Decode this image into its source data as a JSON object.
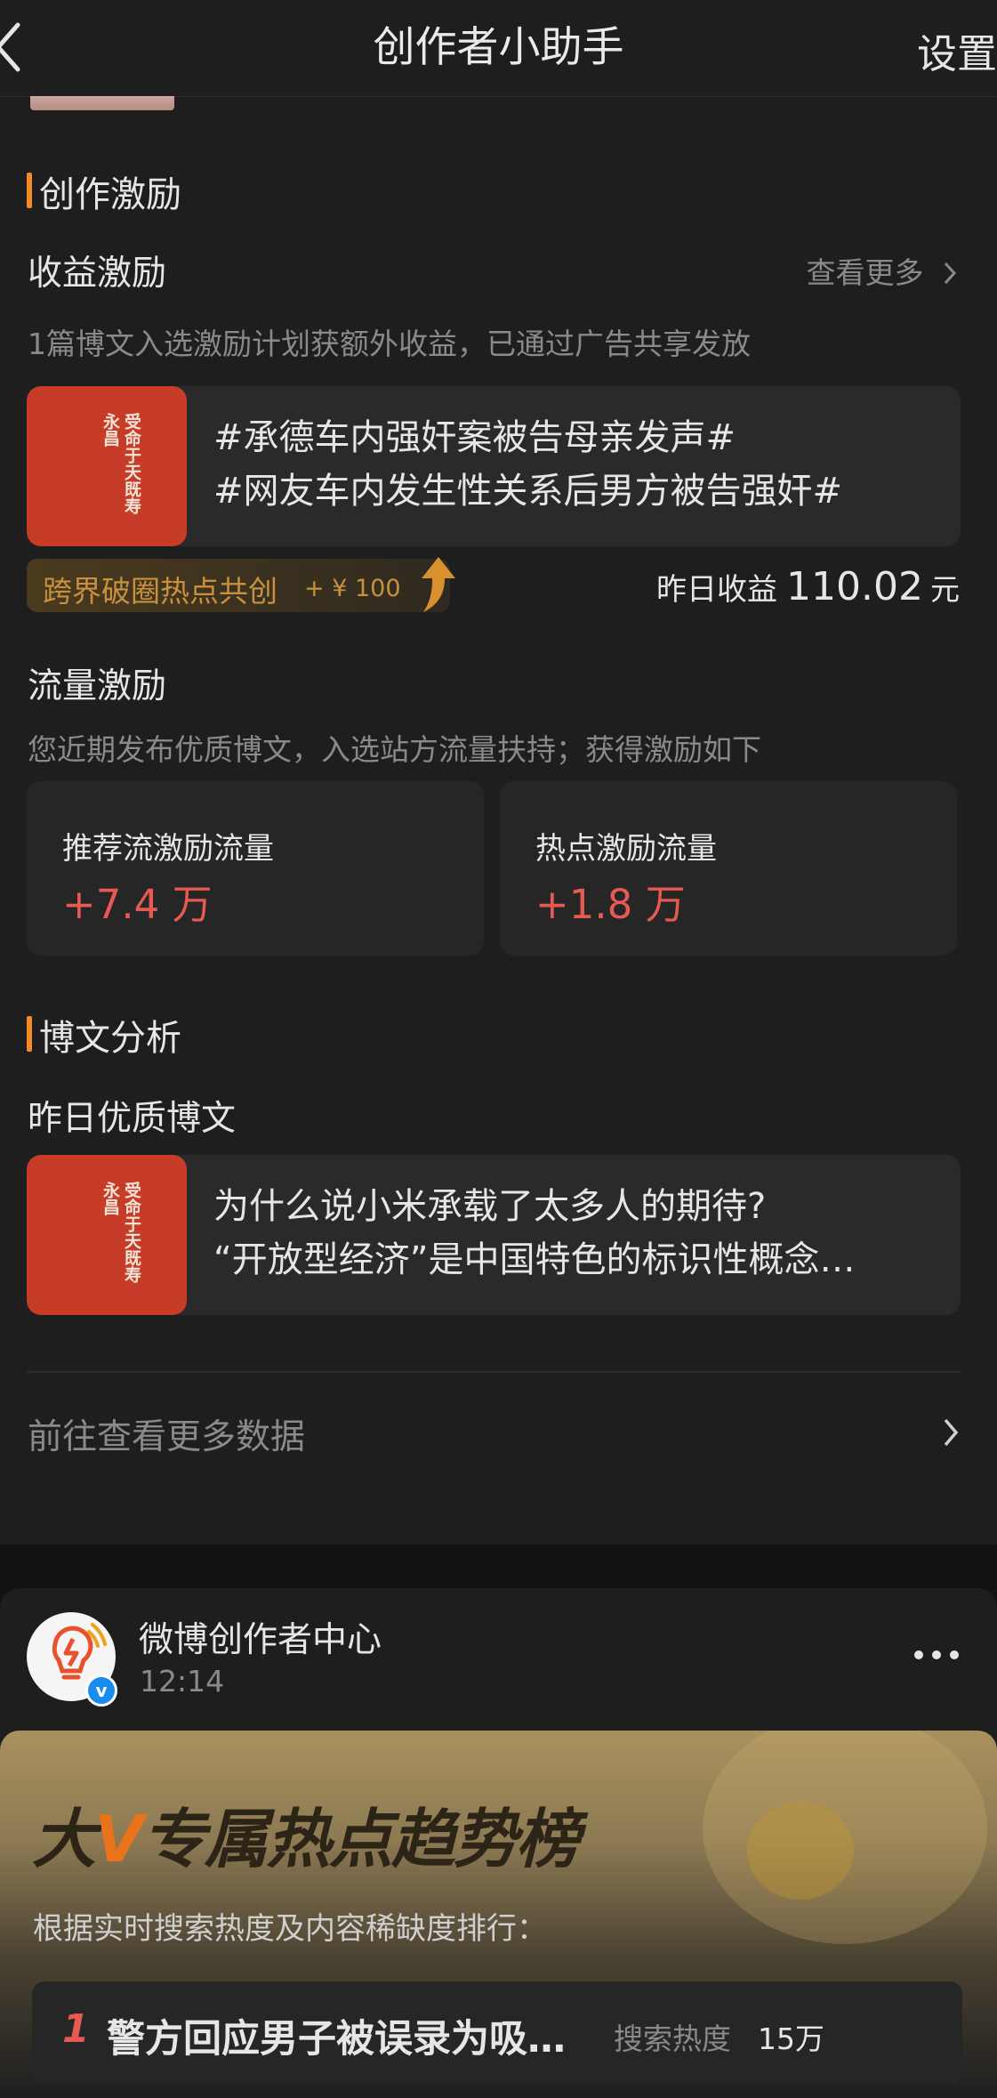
{
  "header": {
    "title": "创作者小助手",
    "settings_label": "设置"
  },
  "incentive": {
    "section_title": "创作激励",
    "earnings": {
      "title": "收益激励",
      "more_label": "查看更多",
      "description": "1篇博文入选激励计划获额外收益，已通过广告共享发放",
      "post_lines": [
        "#承德车内强奸案被告母亲发声#",
        "#网友车内发生性关系后男方被告强奸#"
      ],
      "promo_label": "跨界破圈热点共创",
      "promo_amount": "+ ¥ 100",
      "yesterday_label": "昨日收益",
      "yesterday_value": "110.02",
      "yesterday_unit": "元"
    },
    "traffic": {
      "title": "流量激励",
      "description": "您近期发布优质博文，入选站方流量扶持；获得激励如下",
      "stats": [
        {
          "label": "推荐流激励流量",
          "value": "+7.4 万"
        },
        {
          "label": "热点激励流量",
          "value": "+1.8 万"
        }
      ]
    }
  },
  "analysis": {
    "section_title": "博文分析",
    "quality_title": "昨日优质博文",
    "post_lines": [
      "为什么说小米承载了太多人的期待?",
      "“开放型经济”是中国特色的标识性概念…"
    ],
    "goto_label": "前往查看更多数据"
  },
  "thumb_calligraphy": "受命于天既寿永昌",
  "feed": {
    "account_name": "微博创作者中心",
    "time": "12:14",
    "banner": {
      "title_pre": "大",
      "title_v": "V",
      "title_post": "专属热点趋势榜",
      "subtitle": "根据实时搜索热度及内容稀缺度排行：",
      "rank_no": "1",
      "rank_title": "警方回应男子被误录为吸…",
      "heat_label": "搜索热度",
      "heat_value": "15万"
    }
  },
  "colors": {
    "accent_orange": "#f08b28",
    "stat_red": "#e55a52",
    "background": "#1e1e1e"
  }
}
